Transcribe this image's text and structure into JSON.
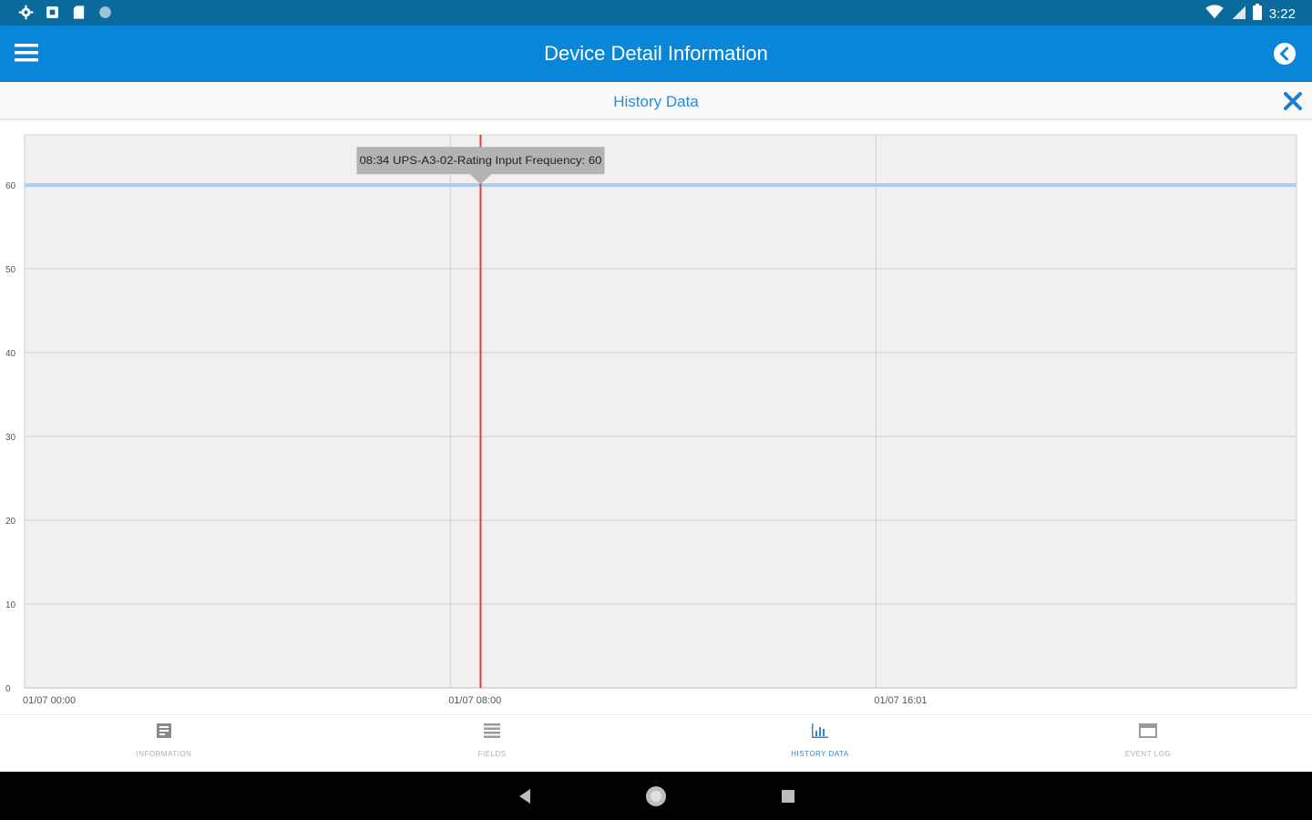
{
  "status_bar": {
    "time": "3:22",
    "left_icons": [
      "settings-icon",
      "notification-icon",
      "sd-card-icon",
      "sync-icon"
    ],
    "right_icons": [
      "wifi-icon",
      "cell-signal-icon",
      "battery-icon"
    ]
  },
  "app_bar": {
    "title": "Device Detail Information",
    "menu_icon": "hamburger-menu-icon",
    "back_icon": "back-circle-icon",
    "color": "#0a86d8"
  },
  "sub_header": {
    "title": "History Data",
    "close_icon": "close-icon"
  },
  "tooltip": {
    "text": "08:34 UPS-A3-02-Rating Input Frequency: 60"
  },
  "chart_data": {
    "type": "line",
    "title": "",
    "xlabel": "",
    "ylabel": "",
    "ylim": [
      0,
      65
    ],
    "yticks": [
      "0",
      "10",
      "20",
      "30",
      "40",
      "50",
      "60"
    ],
    "ytick_values": [
      0,
      10,
      20,
      30,
      40,
      50,
      60
    ],
    "xticks": [
      "01/07 00:00",
      "01/07 08:00",
      "01/07 16:01"
    ],
    "xlim_hours": [
      0,
      24
    ],
    "xtick_hours": [
      0,
      8,
      16
    ],
    "series": [
      {
        "name": "UPS-A3-02-Rating Input Frequency",
        "x_hours": [
          0,
          24
        ],
        "values": [
          60,
          60
        ],
        "color": "#a9cdee"
      }
    ],
    "cursor": {
      "time": "08:34",
      "x_hours": 8.57,
      "value": 60,
      "color": "#e53935"
    },
    "grid": true,
    "background": "#f0f0f0",
    "legend": "none"
  },
  "bottom_nav": {
    "items": [
      {
        "label": "INFORMATION",
        "icon": "information-icon",
        "active": false
      },
      {
        "label": "FIELDS",
        "icon": "fields-list-icon",
        "active": false
      },
      {
        "label": "HISTORY DATA",
        "icon": "history-chart-icon",
        "active": true
      },
      {
        "label": "EVENT LOG",
        "icon": "event-log-icon",
        "active": false
      }
    ]
  },
  "system_nav": {
    "icons": [
      "back-triangle-icon",
      "home-circle-icon",
      "recents-square-icon"
    ]
  }
}
